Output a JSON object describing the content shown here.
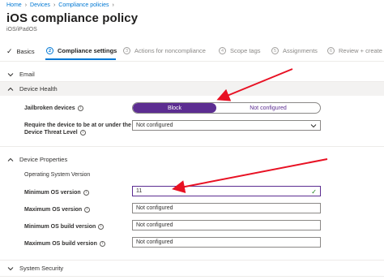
{
  "breadcrumb": {
    "home": "Home",
    "devices": "Devices",
    "policies": "Compliance policies"
  },
  "title": "iOS compliance policy",
  "subtitle": "iOS/iPadOS",
  "wizard": {
    "basics": "Basics",
    "compliance_num": "2",
    "compliance": "Compliance settings",
    "actions_num": "3",
    "actions": "Actions for noncompliance",
    "scope_num": "4",
    "scope": "Scope tags",
    "assignments_num": "5",
    "assignments": "Assignments",
    "review_num": "6",
    "review": "Review + create"
  },
  "sections": {
    "email": "Email",
    "device_health": "Device Health",
    "device_properties": "Device Properties",
    "system_security": "System Security"
  },
  "device_health": {
    "jailbroken_label": "Jailbroken devices",
    "jailbroken_on": "Block",
    "jailbroken_off": "Not configured",
    "threat_label_line1": "Require the device to be at or under the",
    "threat_label_line2": "Device Threat Level",
    "threat_value": "Not configured"
  },
  "device_properties": {
    "os_version_heading": "Operating System Version",
    "min_os_label": "Minimum OS version",
    "min_os_value": "11",
    "max_os_label": "Maximum OS version",
    "max_os_value": "Not configured",
    "min_build_label": "Minimum OS build version",
    "min_build_value": "Not configured",
    "max_build_label": "Maximum OS build version",
    "max_build_value": "Not configured"
  },
  "colors": {
    "accent": "#5c2d91",
    "link": "#0078d4",
    "annotation": "#e81123",
    "valid": "#107c10"
  }
}
